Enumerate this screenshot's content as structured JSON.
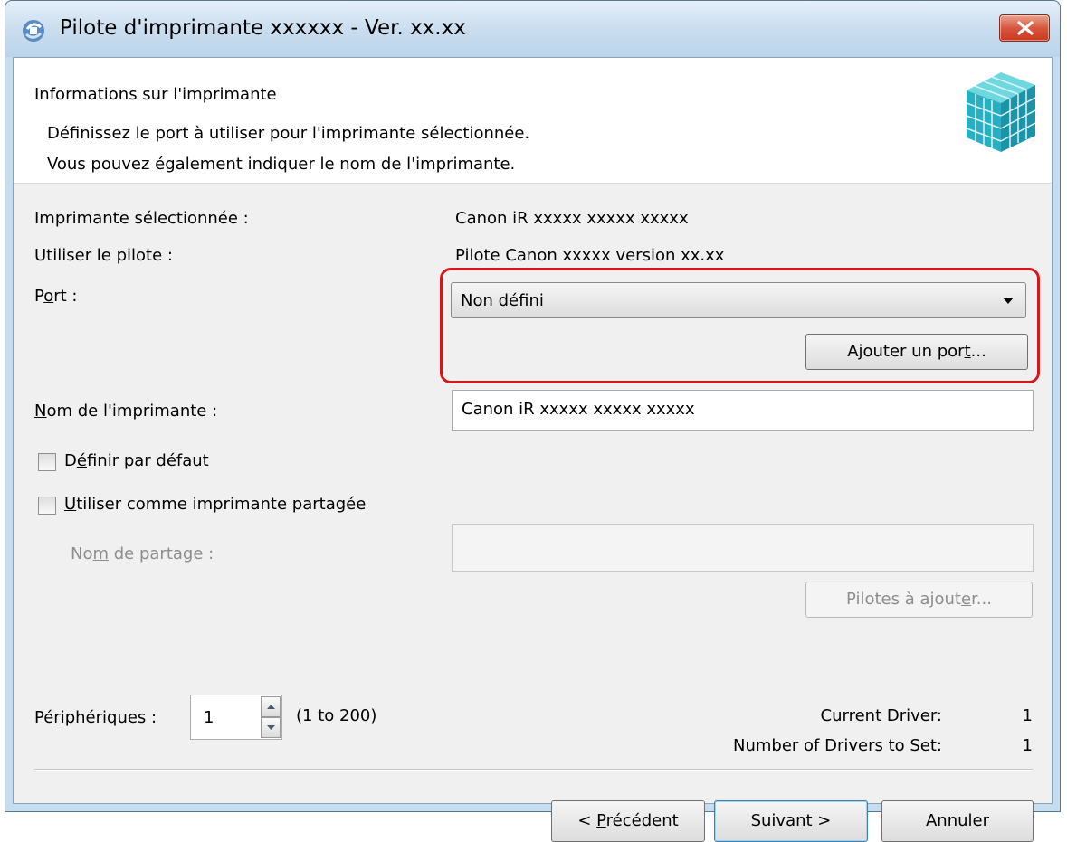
{
  "window": {
    "title": "Pilote d'imprimante xxxxxx - Ver. xx.xx",
    "close_icon": "close-icon"
  },
  "header": {
    "title": "Informations sur l'imprimante",
    "desc_line1": "Définissez le port à utiliser pour l'imprimante sélectionnée.",
    "desc_line2": "Vous pouvez également indiquer le nom de l'imprimante."
  },
  "fields": {
    "selected_printer_label": "Imprimante sélectionnée :",
    "selected_printer_value": "Canon iR xxxxx xxxxx xxxxx",
    "driver_label": "Utiliser le pilote :",
    "driver_value": "Pilote Canon  xxxxx  version xx.xx",
    "port_label_a": "P",
    "port_label_u": "o",
    "port_label_b": "rt :",
    "port_value": "Non défini",
    "add_port_a": "Ajouter un por",
    "add_port_u": "t",
    "add_port_b": "...",
    "printer_name_label_u": "N",
    "printer_name_label_b": "om de l'imprimante :",
    "printer_name_value": "Canon iR xxxxx xxxxx xxxxx",
    "default_a": "D",
    "default_u": "é",
    "default_b": "finir par défaut",
    "share_u": "U",
    "share_b": "tiliser comme imprimante partagée",
    "share_name_a": "No",
    "share_name_u": "m",
    "share_name_b": " de partage :",
    "drivers_btn_a": "Pilotes à ajout",
    "drivers_btn_u": "e",
    "drivers_btn_b": "r...",
    "devices_a": "Pé",
    "devices_u": "r",
    "devices_b": "iphériques :",
    "devices_value": "1",
    "devices_range": "(1 to 200)",
    "current_driver_label": "Current Driver:",
    "current_driver_value": "1",
    "drivers_to_set_label": "Number of Drivers to Set:",
    "drivers_to_set_value": "1"
  },
  "footer": {
    "back_a": "< ",
    "back_u": "P",
    "back_b": "récédent",
    "next": "Suivant >",
    "cancel": "Annuler"
  },
  "colors": {
    "highlight": "#d2191f",
    "close_button": "#d8563c",
    "title_bar": "#c8dcee"
  }
}
